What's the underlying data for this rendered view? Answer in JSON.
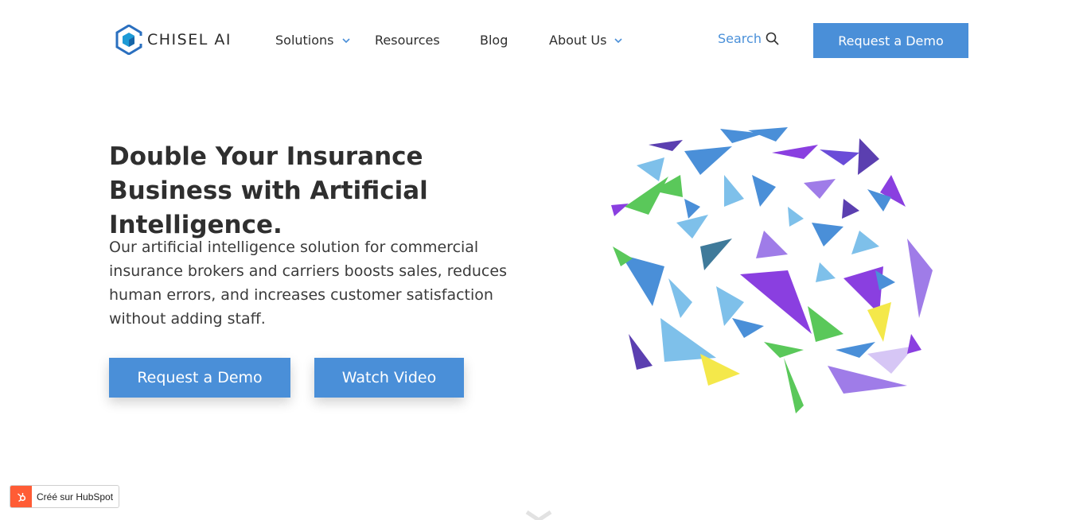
{
  "header": {
    "logo_text": "CHISEL AI",
    "nav": [
      {
        "label": "Solutions",
        "has_dropdown": true
      },
      {
        "label": "Resources",
        "has_dropdown": false
      },
      {
        "label": "Blog",
        "has_dropdown": false
      },
      {
        "label": "About Us",
        "has_dropdown": true
      }
    ],
    "search_label": "Search",
    "cta_label": "Request a Demo"
  },
  "hero": {
    "title": "Double Your Insurance Business with Artificial Intelligence.",
    "description": "Our artificial intelligence solution for commercial insurance brokers and carriers boosts sales, reduces human errors, and increases customer satisfaction without adding staff.",
    "primary_button": "Request a Demo",
    "secondary_button": "Watch Video"
  },
  "badge": {
    "text": "Créé sur HubSpot"
  },
  "colors": {
    "accent": "#4a8fd8",
    "text": "#2f2f2f",
    "hubspot": "#ff5c35"
  },
  "icons": [
    "chisel-logo-icon",
    "chevron-down-icon",
    "search-icon",
    "brain-illustration",
    "hubspot-sprocket-icon",
    "scroll-down-icon"
  ]
}
